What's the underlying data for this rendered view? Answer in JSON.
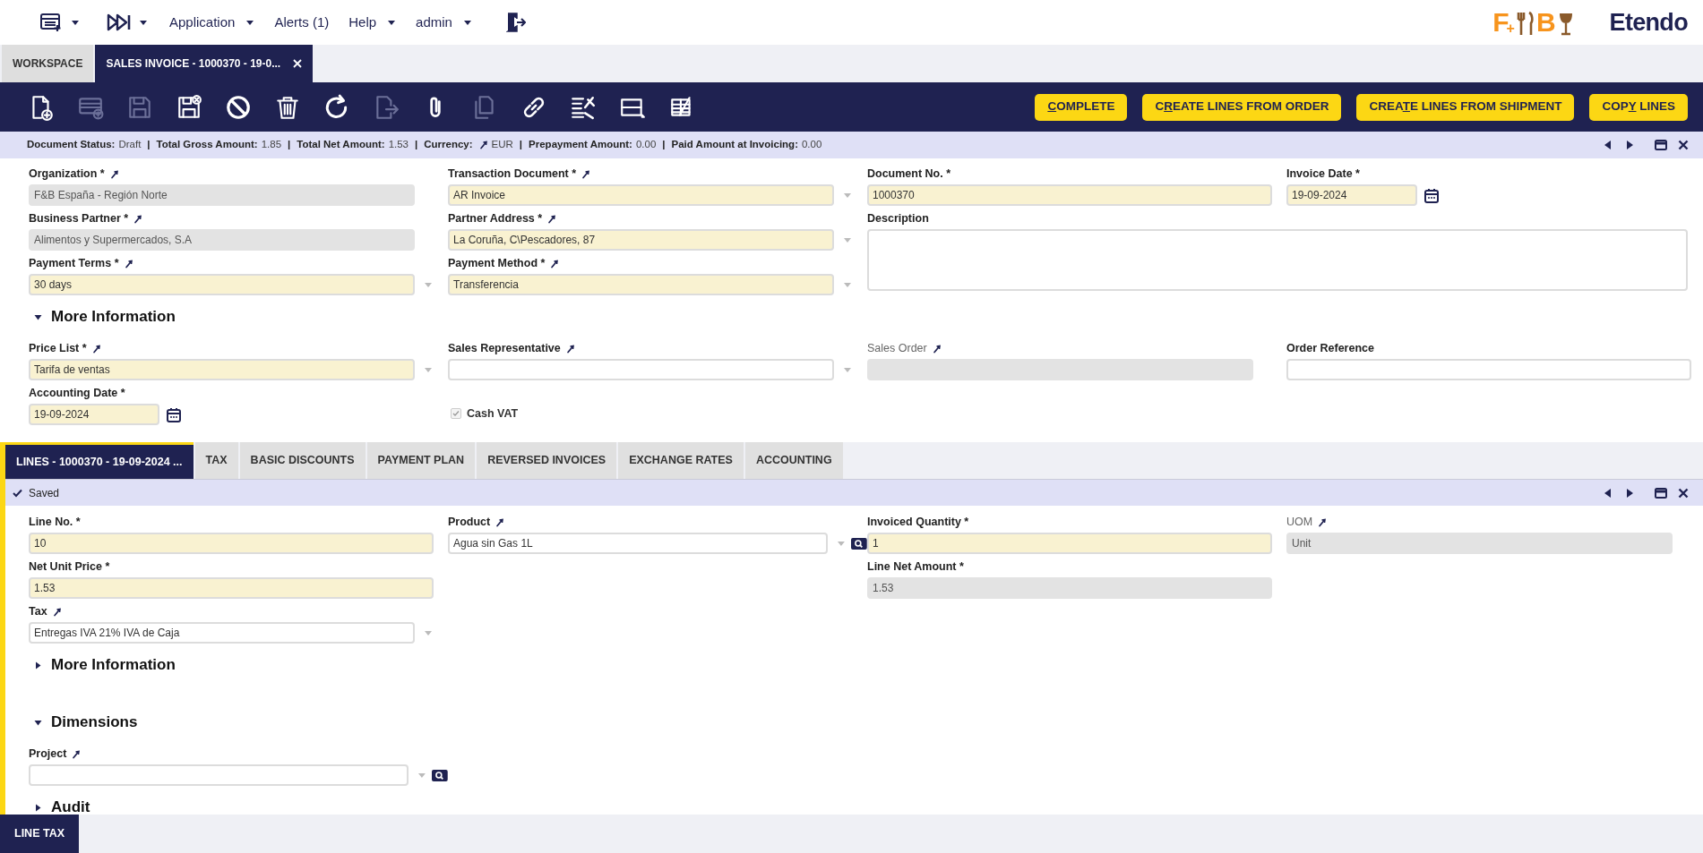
{
  "top_nav": {
    "menus": [
      {
        "label": "Application",
        "caret": true
      },
      {
        "label": "Alerts (1)",
        "caret": false
      },
      {
        "label": "Help",
        "caret": true
      },
      {
        "label": "admin",
        "caret": true
      }
    ],
    "partner_logo": [
      "F",
      "+",
      "B"
    ],
    "brand": "Etendo"
  },
  "window_tabs": [
    {
      "label": "WORKSPACE",
      "selected": false,
      "closable": false
    },
    {
      "label": "SALES INVOICE - 1000370 - 19-0...",
      "selected": true,
      "closable": true
    }
  ],
  "toolbar": {
    "icons": [
      {
        "disabled": false
      },
      {
        "disabled": true
      },
      {
        "disabled": true
      },
      {
        "disabled": false
      },
      {
        "disabled": false
      },
      {
        "disabled": false
      },
      {
        "disabled": false
      },
      {
        "disabled": true
      },
      {
        "disabled": false
      },
      {
        "disabled": true
      },
      {
        "disabled": false
      },
      {
        "disabled": false
      },
      {
        "disabled": false
      },
      {
        "disabled": false
      }
    ],
    "buttons": [
      {
        "key": "C",
        "after": "OMPLETE"
      },
      {
        "before": "C",
        "key": "R",
        "after": "EATE LINES FROM ORDER"
      },
      {
        "before": "CREA",
        "key": "T",
        "after": "E LINES FROM SHIPMENT"
      },
      {
        "before": "COP",
        "key": "Y",
        "after": " LINES"
      }
    ]
  },
  "status_bar": {
    "items": [
      {
        "label": "Document Status:",
        "value": "Draft"
      },
      {
        "label": "Total Gross Amount:",
        "value": "1.85"
      },
      {
        "label": "Total Net Amount:",
        "value": "1.53"
      },
      {
        "label": "Currency:",
        "value": "EUR",
        "linked": true
      },
      {
        "label": "Prepayment Amount:",
        "value": "0.00"
      },
      {
        "label": "Paid Amount at Invoicing:",
        "value": "0.00"
      }
    ],
    "separators": [
      "|",
      "|",
      "|",
      "|",
      "|"
    ]
  },
  "header": {
    "fields": [
      {
        "kind": "select",
        "label": "Organization *",
        "linked": true,
        "value": "F&B España - Región Norte",
        "readonly": true
      },
      {
        "kind": "select",
        "label": "Transaction Document *",
        "linked": true,
        "value": "AR Invoice",
        "required": true,
        "readonly": false
      },
      {
        "kind": "text",
        "label": "Document No. *",
        "value": "1000370",
        "required": true,
        "readonly": false
      },
      {
        "kind": "date",
        "label": "Invoice Date *",
        "value": "19-09-2024",
        "required": true,
        "readonly": false
      },
      {
        "kind": "select",
        "label": "Business Partner *",
        "linked": true,
        "value": "Alimentos y Supermercados, S.A",
        "readonly": true
      },
      {
        "kind": "select",
        "label": "Partner Address *",
        "linked": true,
        "value": "La Coruña, C\\Pescadores, 87",
        "required": true,
        "readonly": false
      },
      {
        "kind": "textarea",
        "label": "Description",
        "required": false,
        "readonly": false
      },
      {
        "kind": "select",
        "label": "Payment Terms *",
        "linked": true,
        "value": "30 days",
        "required": true,
        "readonly": false
      },
      {
        "kind": "select",
        "label": "Payment Method *",
        "linked": true,
        "value": "Transferencia",
        "required": true,
        "readonly": false
      }
    ],
    "sections": [
      {
        "title": "More Information",
        "expanded": true,
        "fields": [
          {
            "kind": "select",
            "label": "Price List *",
            "linked": true,
            "value": "Tarifa de ventas",
            "required": true,
            "readonly": false
          },
          {
            "kind": "select",
            "label": "Sales Representative",
            "linked": true,
            "required": false,
            "readonly": false
          },
          {
            "kind": "select",
            "label": "Sales Order",
            "linked": true,
            "readonly": true,
            "label_dimmed": true
          },
          {
            "kind": "text",
            "label": "Order Reference",
            "required": false,
            "readonly": false
          },
          {
            "kind": "date",
            "label": "Accounting Date *",
            "value": "19-09-2024",
            "required": true,
            "readonly": false
          },
          {
            "kind": "checkbox",
            "label": "Cash VAT",
            "checked": true,
            "disabled": true
          }
        ]
      }
    ]
  },
  "lines": {
    "tabs": [
      {
        "label": "LINES - 1000370 - 19-09-2024 ...",
        "selected": true
      },
      {
        "label": "TAX",
        "selected": false
      },
      {
        "label": "BASIC DISCOUNTS",
        "selected": false
      },
      {
        "label": "PAYMENT PLAN",
        "selected": false
      },
      {
        "label": "REVERSED INVOICES",
        "selected": false
      },
      {
        "label": "EXCHANGE RATES",
        "selected": false
      },
      {
        "label": "ACCOUNTING",
        "selected": false
      }
    ],
    "status": "Saved",
    "fields": [
      {
        "kind": "text",
        "label": "Line No. *",
        "value": "10",
        "required": true,
        "readonly": false
      },
      {
        "kind": "search",
        "label": "Product",
        "linked": true,
        "value": "Agua sin Gas 1L",
        "required": false,
        "readonly": false
      },
      {
        "kind": "text",
        "label": "Invoiced Quantity *",
        "value": "1",
        "required": true,
        "readonly": false
      },
      {
        "kind": "select",
        "label": "UOM",
        "linked": true,
        "value": "Unit",
        "readonly": true,
        "label_dimmed": true
      },
      {
        "kind": "text",
        "label": "Net Unit Price *",
        "value": "1.53",
        "required": true,
        "readonly": false
      },
      {
        "kind": "spacer"
      },
      {
        "kind": "text",
        "label": "Line Net Amount *",
        "value": "1.53",
        "readonly": true
      },
      {
        "kind": "spacer"
      },
      {
        "kind": "select",
        "label": "Tax",
        "linked": true,
        "value": "Entregas IVA 21% IVA de Caja",
        "required": false,
        "readonly": false
      }
    ],
    "sections": [
      {
        "title": "More Information",
        "expanded": false
      },
      {
        "title": "Dimensions",
        "expanded": true,
        "fields": [
          {
            "kind": "search",
            "label": "Project",
            "linked": true,
            "required": false,
            "readonly": false
          }
        ]
      },
      {
        "title": "Audit",
        "expanded": false
      }
    ]
  },
  "bottom_tabs": [
    {
      "label": "LINE TAX",
      "selected": true
    }
  ]
}
